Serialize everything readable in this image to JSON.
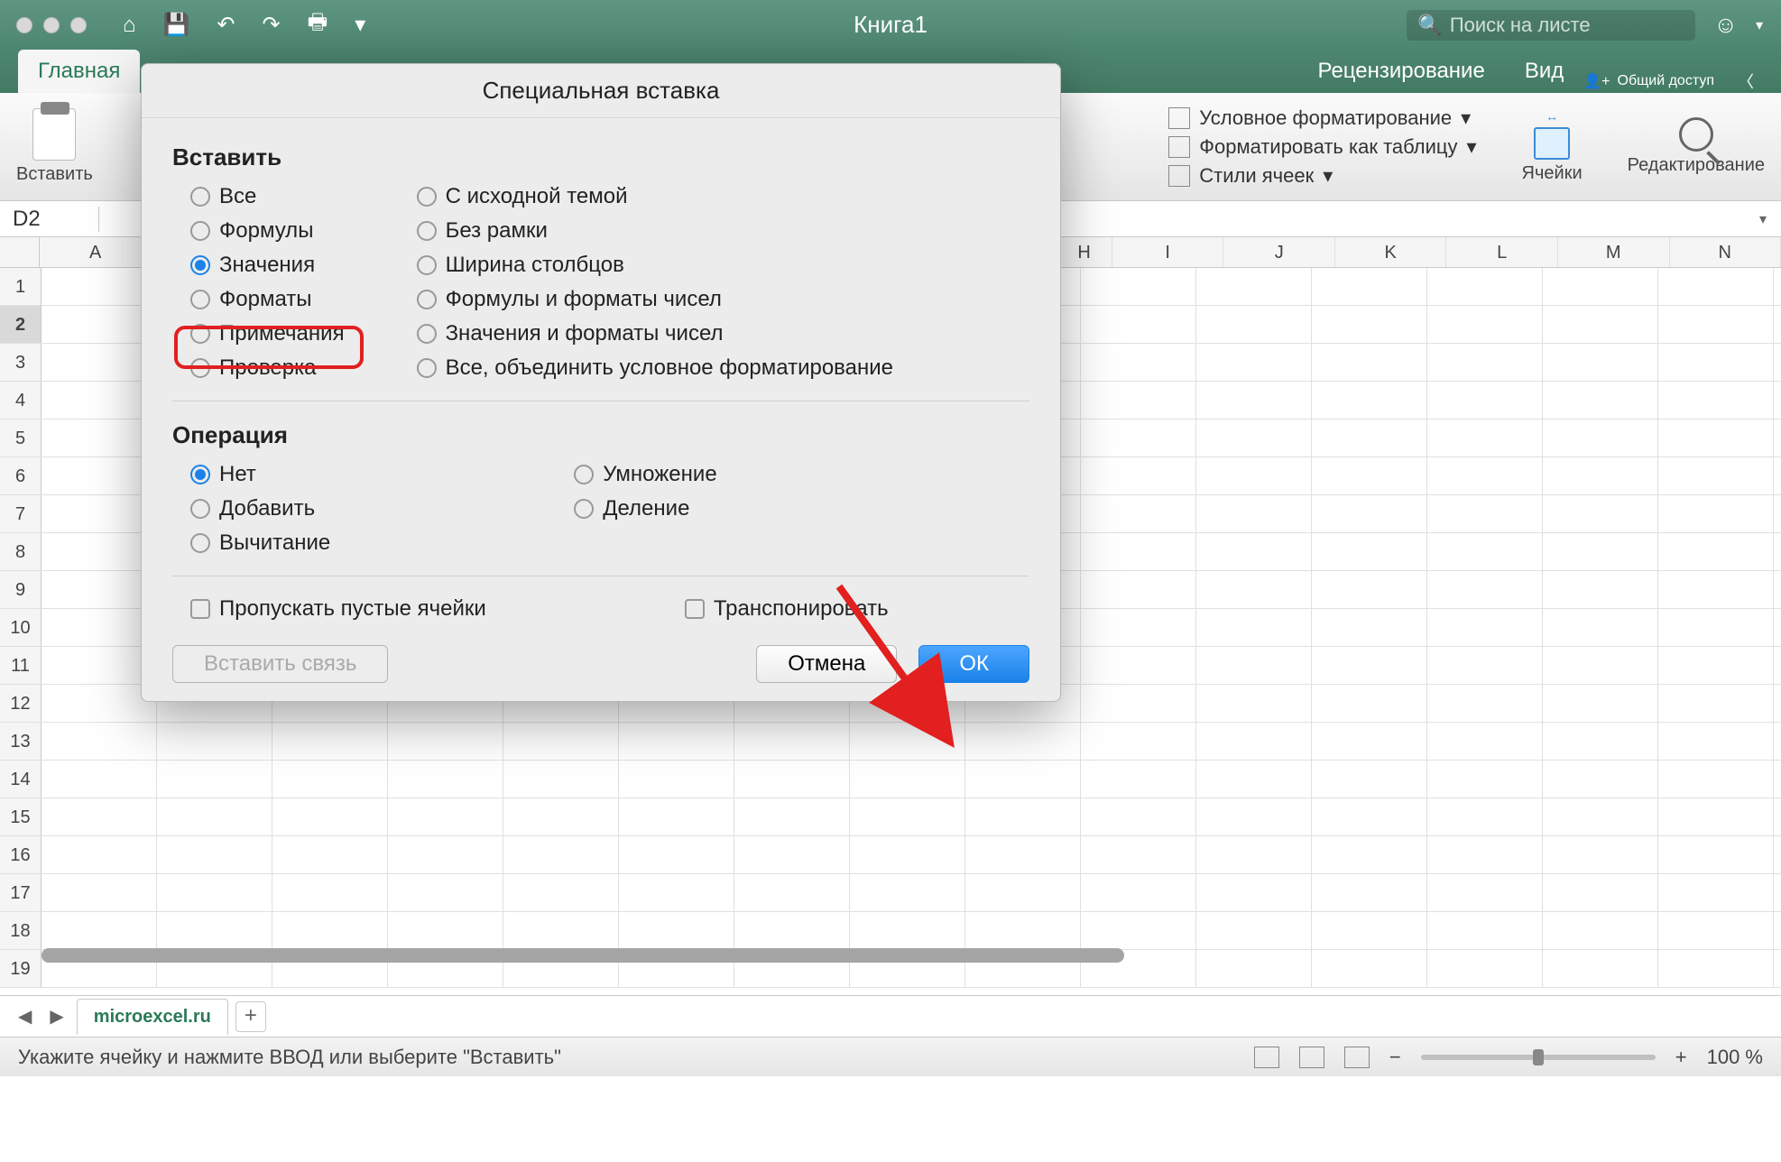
{
  "window": {
    "title": "Книга1",
    "search_placeholder": "Поиск на листе"
  },
  "tabs": {
    "active": "Главная",
    "list": [
      "Главная",
      "Рецензирование",
      "Вид"
    ],
    "share": "Общий доступ"
  },
  "ribbon": {
    "paste_label": "Вставить",
    "conditional": "Условное форматирование",
    "format_table": "Форматировать как таблицу",
    "cell_styles": "Стили ячеек",
    "cells": "Ячейки",
    "editing": "Редактирование"
  },
  "namebox": "D2",
  "columns": [
    "A",
    "H",
    "I",
    "J",
    "K",
    "L",
    "M",
    "N"
  ],
  "row_numbers": [
    1,
    2,
    3,
    4,
    5,
    6,
    7,
    8,
    9,
    10,
    11,
    12,
    13,
    14,
    15,
    16,
    17,
    18,
    19
  ],
  "selected_row": 2,
  "sheet": {
    "name": "microexcel.ru"
  },
  "status": {
    "text": "Укажите ячейку и нажмите ВВОД или выберите \"Вставить\"",
    "zoom": "100 %"
  },
  "dialog": {
    "title": "Специальная вставка",
    "section_paste": "Вставить",
    "paste_left": [
      "Все",
      "Формулы",
      "Значения",
      "Форматы",
      "Примечания",
      "Проверка"
    ],
    "paste_left_selected": "Значения",
    "paste_right": [
      "С исходной темой",
      "Без рамки",
      "Ширина столбцов",
      "Формулы и форматы чисел",
      "Значения и форматы чисел",
      "Все, объединить условное форматирование"
    ],
    "section_op": "Операция",
    "op_left": [
      "Нет",
      "Добавить",
      "Вычитание"
    ],
    "op_left_selected": "Нет",
    "op_right": [
      "Умножение",
      "Деление"
    ],
    "cb_skip": "Пропускать пустые ячейки",
    "cb_transpose": "Транспонировать",
    "btn_link": "Вставить связь",
    "btn_cancel": "Отмена",
    "btn_ok": "ОК"
  }
}
